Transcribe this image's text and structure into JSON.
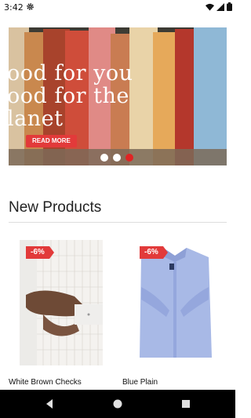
{
  "status_bar": {
    "time": "3:42"
  },
  "banner": {
    "text": "ood for you\nood for the\nlanet",
    "button_label": "READ MORE",
    "slides": [
      false,
      false,
      true
    ]
  },
  "section": {
    "title": "New Products"
  },
  "products": [
    {
      "name": "White Brown Checks",
      "discount": "-6%"
    },
    {
      "name": "Blue Plain",
      "discount": "-6%"
    }
  ],
  "colors": {
    "accent": "#e23a3a",
    "active_dot": "#e02424"
  }
}
